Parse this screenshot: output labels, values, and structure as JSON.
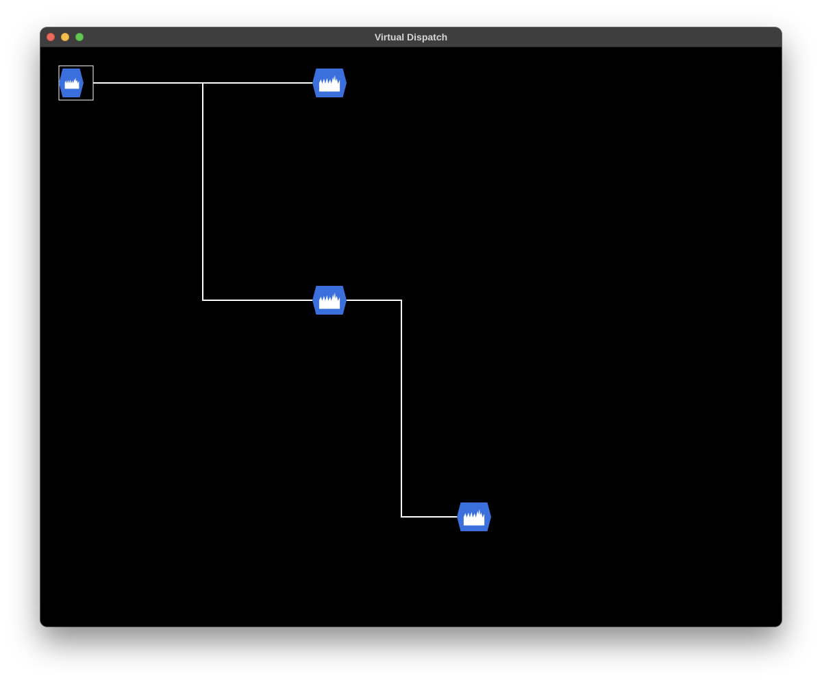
{
  "window": {
    "title": "Virtual Dispatch"
  },
  "colors": {
    "node_fill": "#3a6fdc",
    "edge_stroke": "#ffffff",
    "canvas_bg": "#000000",
    "selection": "#ffffff"
  },
  "graph": {
    "nodes": [
      {
        "id": "node-1",
        "icon": "factory-icon",
        "selected": true
      },
      {
        "id": "node-2",
        "icon": "factory-icon",
        "selected": false
      },
      {
        "id": "node-3",
        "icon": "factory-icon",
        "selected": false
      },
      {
        "id": "node-4",
        "icon": "factory-icon",
        "selected": false
      }
    ],
    "edges": [
      {
        "from": "node-1",
        "to": "node-2"
      },
      {
        "from": "node-1",
        "to": "node-3"
      },
      {
        "from": "node-3",
        "to": "node-4"
      }
    ]
  }
}
